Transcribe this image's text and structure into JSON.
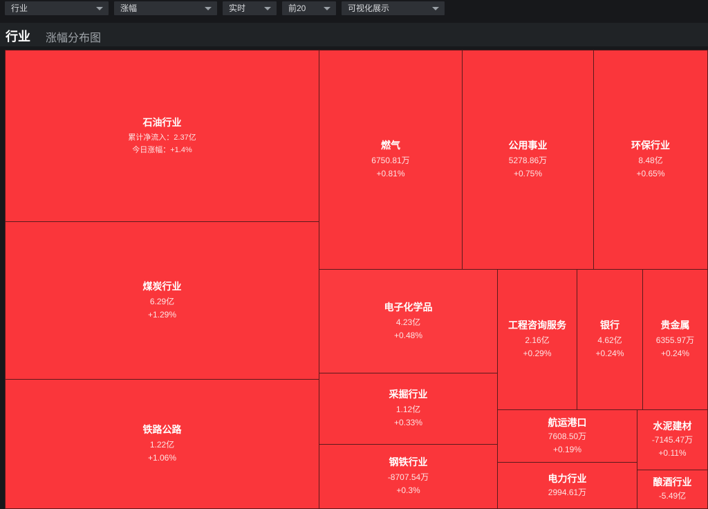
{
  "filters": {
    "category": "行业",
    "metric": "涨幅",
    "period": "实时",
    "topn": "前20",
    "view": "可视化展示"
  },
  "title": {
    "main": "行业",
    "sub": "涨幅分布图"
  },
  "treemap": [
    {
      "name": "石油行业",
      "line1": "累计净流入：2.37亿",
      "line2": "今日涨幅：+1.4%",
      "small": true
    },
    {
      "name": "煤炭行业",
      "line1": "6.29亿",
      "line2": "+1.29%"
    },
    {
      "name": "铁路公路",
      "line1": "1.22亿",
      "line2": "+1.06%"
    },
    {
      "name": "燃气",
      "line1": "6750.81万",
      "line2": "+0.81%"
    },
    {
      "name": "公用事业",
      "line1": "5278.86万",
      "line2": "+0.75%"
    },
    {
      "name": "环保行业",
      "line1": "8.48亿",
      "line2": "+0.65%"
    },
    {
      "name": "电子化学品",
      "line1": "4.23亿",
      "line2": "+0.48%"
    },
    {
      "name": "采掘行业",
      "line1": "1.12亿",
      "line2": "+0.33%"
    },
    {
      "name": "钢铁行业",
      "line1": "-8707.54万",
      "line2": "+0.3%"
    },
    {
      "name": "工程咨询服务",
      "line1": "2.16亿",
      "line2": "+0.29%"
    },
    {
      "name": "银行",
      "line1": "4.62亿",
      "line2": "+0.24%"
    },
    {
      "name": "贵金属",
      "line1": "6355.97万",
      "line2": "+0.24%"
    },
    {
      "name": "航运港口",
      "line1": "7608.50万",
      "line2": "+0.19%"
    },
    {
      "name": "水泥建材",
      "line1": "-7145.47万",
      "line2": "+0.11%"
    },
    {
      "name": "电力行业",
      "line1": "2994.61万",
      "line2": ""
    },
    {
      "name": "酿酒行业",
      "line1": "-5.49亿",
      "line2": ""
    }
  ]
}
